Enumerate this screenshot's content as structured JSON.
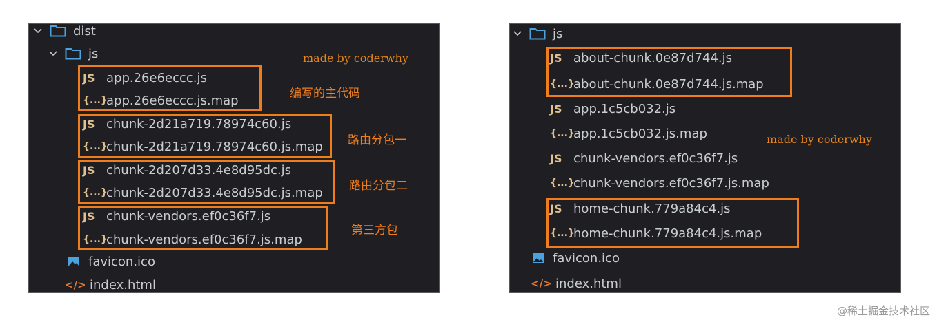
{
  "watermark": "@稀土掘金技术社区",
  "left": {
    "root_folder": "dist",
    "sub_folder": "js",
    "made_by": "made by coderwhy",
    "files": [
      {
        "icon": "JS",
        "name": "app.26e6eccc.js"
      },
      {
        "icon": "{...}",
        "name": "app.26e6eccc.js.map"
      },
      {
        "icon": "JS",
        "name": "chunk-2d21a719.78974c60.js"
      },
      {
        "icon": "{...}",
        "name": "chunk-2d21a719.78974c60.js.map"
      },
      {
        "icon": "JS",
        "name": "chunk-2d207d33.4e8d95dc.js"
      },
      {
        "icon": "{...}",
        "name": "chunk-2d207d33.4e8d95dc.js.map"
      },
      {
        "icon": "JS",
        "name": "chunk-vendors.ef0c36f7.js"
      },
      {
        "icon": "{...}",
        "name": "chunk-vendors.ef0c36f7.js.map"
      }
    ],
    "root_files": [
      {
        "icon": "image",
        "name": "favicon.ico"
      },
      {
        "icon": "</>",
        "name": "index.html"
      }
    ],
    "annotations": [
      "编写的主代码",
      "路由分包一",
      "路由分包二",
      "第三方包"
    ]
  },
  "right": {
    "folder": "js",
    "made_by": "made by coderwhy",
    "files": [
      {
        "icon": "JS",
        "name": "about-chunk.0e87d744.js"
      },
      {
        "icon": "{...}",
        "name": "about-chunk.0e87d744.js.map"
      },
      {
        "icon": "JS",
        "name": "app.1c5cb032.js"
      },
      {
        "icon": "{...}",
        "name": "app.1c5cb032.js.map"
      },
      {
        "icon": "JS",
        "name": "chunk-vendors.ef0c36f7.js"
      },
      {
        "icon": "{...}",
        "name": "chunk-vendors.ef0c36f7.js.map"
      },
      {
        "icon": "JS",
        "name": "home-chunk.779a84c4.js"
      },
      {
        "icon": "{...}",
        "name": "home-chunk.779a84c4.js.map"
      }
    ],
    "root_files": [
      {
        "icon": "image",
        "name": "favicon.ico"
      },
      {
        "icon": "</>",
        "name": "index.html"
      }
    ]
  },
  "colors": {
    "accent": "#f07d1d",
    "js_icon": "#e2c08d",
    "html_icon": "#e37933",
    "folder": "#4aa3df",
    "text": "#c9cdd1",
    "panel_bg": "#1f1f23"
  }
}
